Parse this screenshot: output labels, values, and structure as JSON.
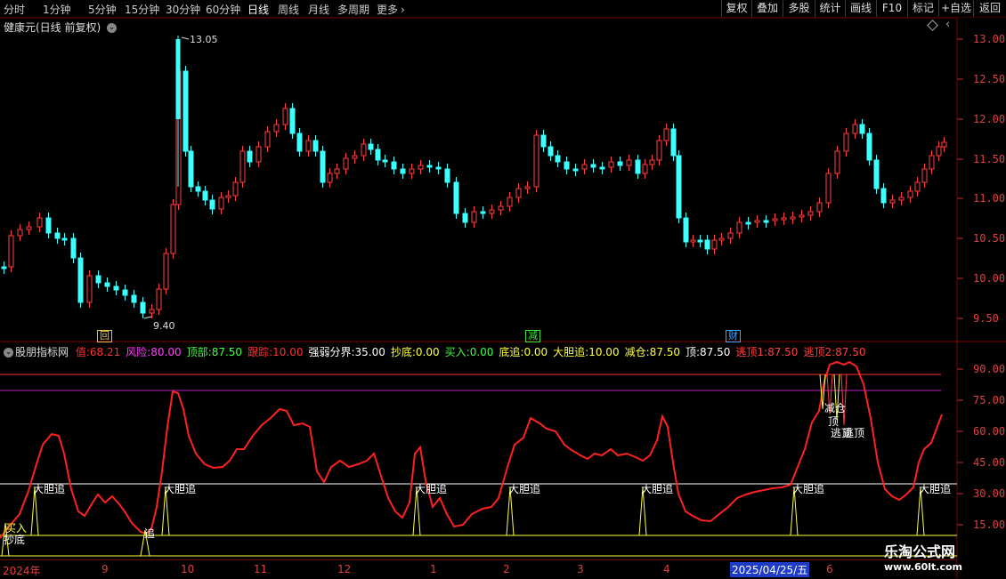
{
  "toolbar": {
    "periods": [
      "分时",
      "1分钟",
      "5分钟",
      "15分钟",
      "30分钟",
      "60分钟",
      "日线",
      "周线",
      "月线",
      "多周期",
      "更多"
    ],
    "active_period": "日线",
    "right_buttons": [
      "复权",
      "叠加",
      "多股",
      "统计",
      "画线",
      "F10",
      "标记",
      "+自选",
      "返回"
    ]
  },
  "main": {
    "title": "健康元(日线 前复权)",
    "y_ticks": [
      "13.00",
      "12.50",
      "12.00",
      "11.50",
      "11.00",
      "10.50",
      "10.00",
      "9.50"
    ],
    "high_label": "13.05",
    "low_label": "9.40",
    "markers": [
      {
        "text": "回",
        "color": "#e8c040"
      },
      {
        "text": "减",
        "color": "#40e040"
      },
      {
        "text": "财",
        "color": "#40a0ff"
      }
    ]
  },
  "indicator": {
    "name": "股朋指标网",
    "values": [
      {
        "label": "值:",
        "value": "68.21",
        "color": "#ff3030"
      },
      {
        "label": "风险:",
        "value": "80.00",
        "color": "#ff40ff"
      },
      {
        "label": "顶部:",
        "value": "87.50",
        "color": "#40ff40"
      },
      {
        "label": "跟踪:",
        "value": "10.00",
        "color": "#ff3030"
      },
      {
        "label": "强弱分界:",
        "value": "35.00",
        "color": "#ffffff"
      },
      {
        "label": "抄底:",
        "value": "0.00",
        "color": "#ffff40"
      },
      {
        "label": "买入:",
        "value": "0.00",
        "color": "#40ff40"
      },
      {
        "label": "底追:",
        "value": "0.00",
        "color": "#ffff40"
      },
      {
        "label": "大胆追:",
        "value": "10.00",
        "color": "#ffff40"
      },
      {
        "label": "减仓:",
        "value": "87.50",
        "color": "#ffff40"
      },
      {
        "label": "顶:",
        "value": "87.50",
        "color": "#ffffff"
      },
      {
        "label": "逃顶1:",
        "value": "87.50",
        "color": "#ff4040"
      },
      {
        "label": "逃顶2:",
        "value": "87.50",
        "color": "#ff4040"
      }
    ],
    "y_ticks": [
      "90.00",
      "75.00",
      "60.00",
      "45.00",
      "30.00",
      "15.00"
    ],
    "signal_text": "大胆追",
    "signal_small": "追",
    "buy_text": "买入",
    "bottom_text": "抄底",
    "reduce_text": "减仓",
    "top_text": "顶",
    "escape_text": "逃顶",
    "escape_text2": "逃顶"
  },
  "xaxis": {
    "labels": [
      "2024年",
      "9",
      "10",
      "11",
      "12",
      "1",
      "2",
      "3",
      "4",
      "5",
      "6"
    ],
    "highlight": "2025/04/25/五"
  },
  "watermark": {
    "line1": "乐淘公式网",
    "line2": "www.60lt.com"
  }
}
